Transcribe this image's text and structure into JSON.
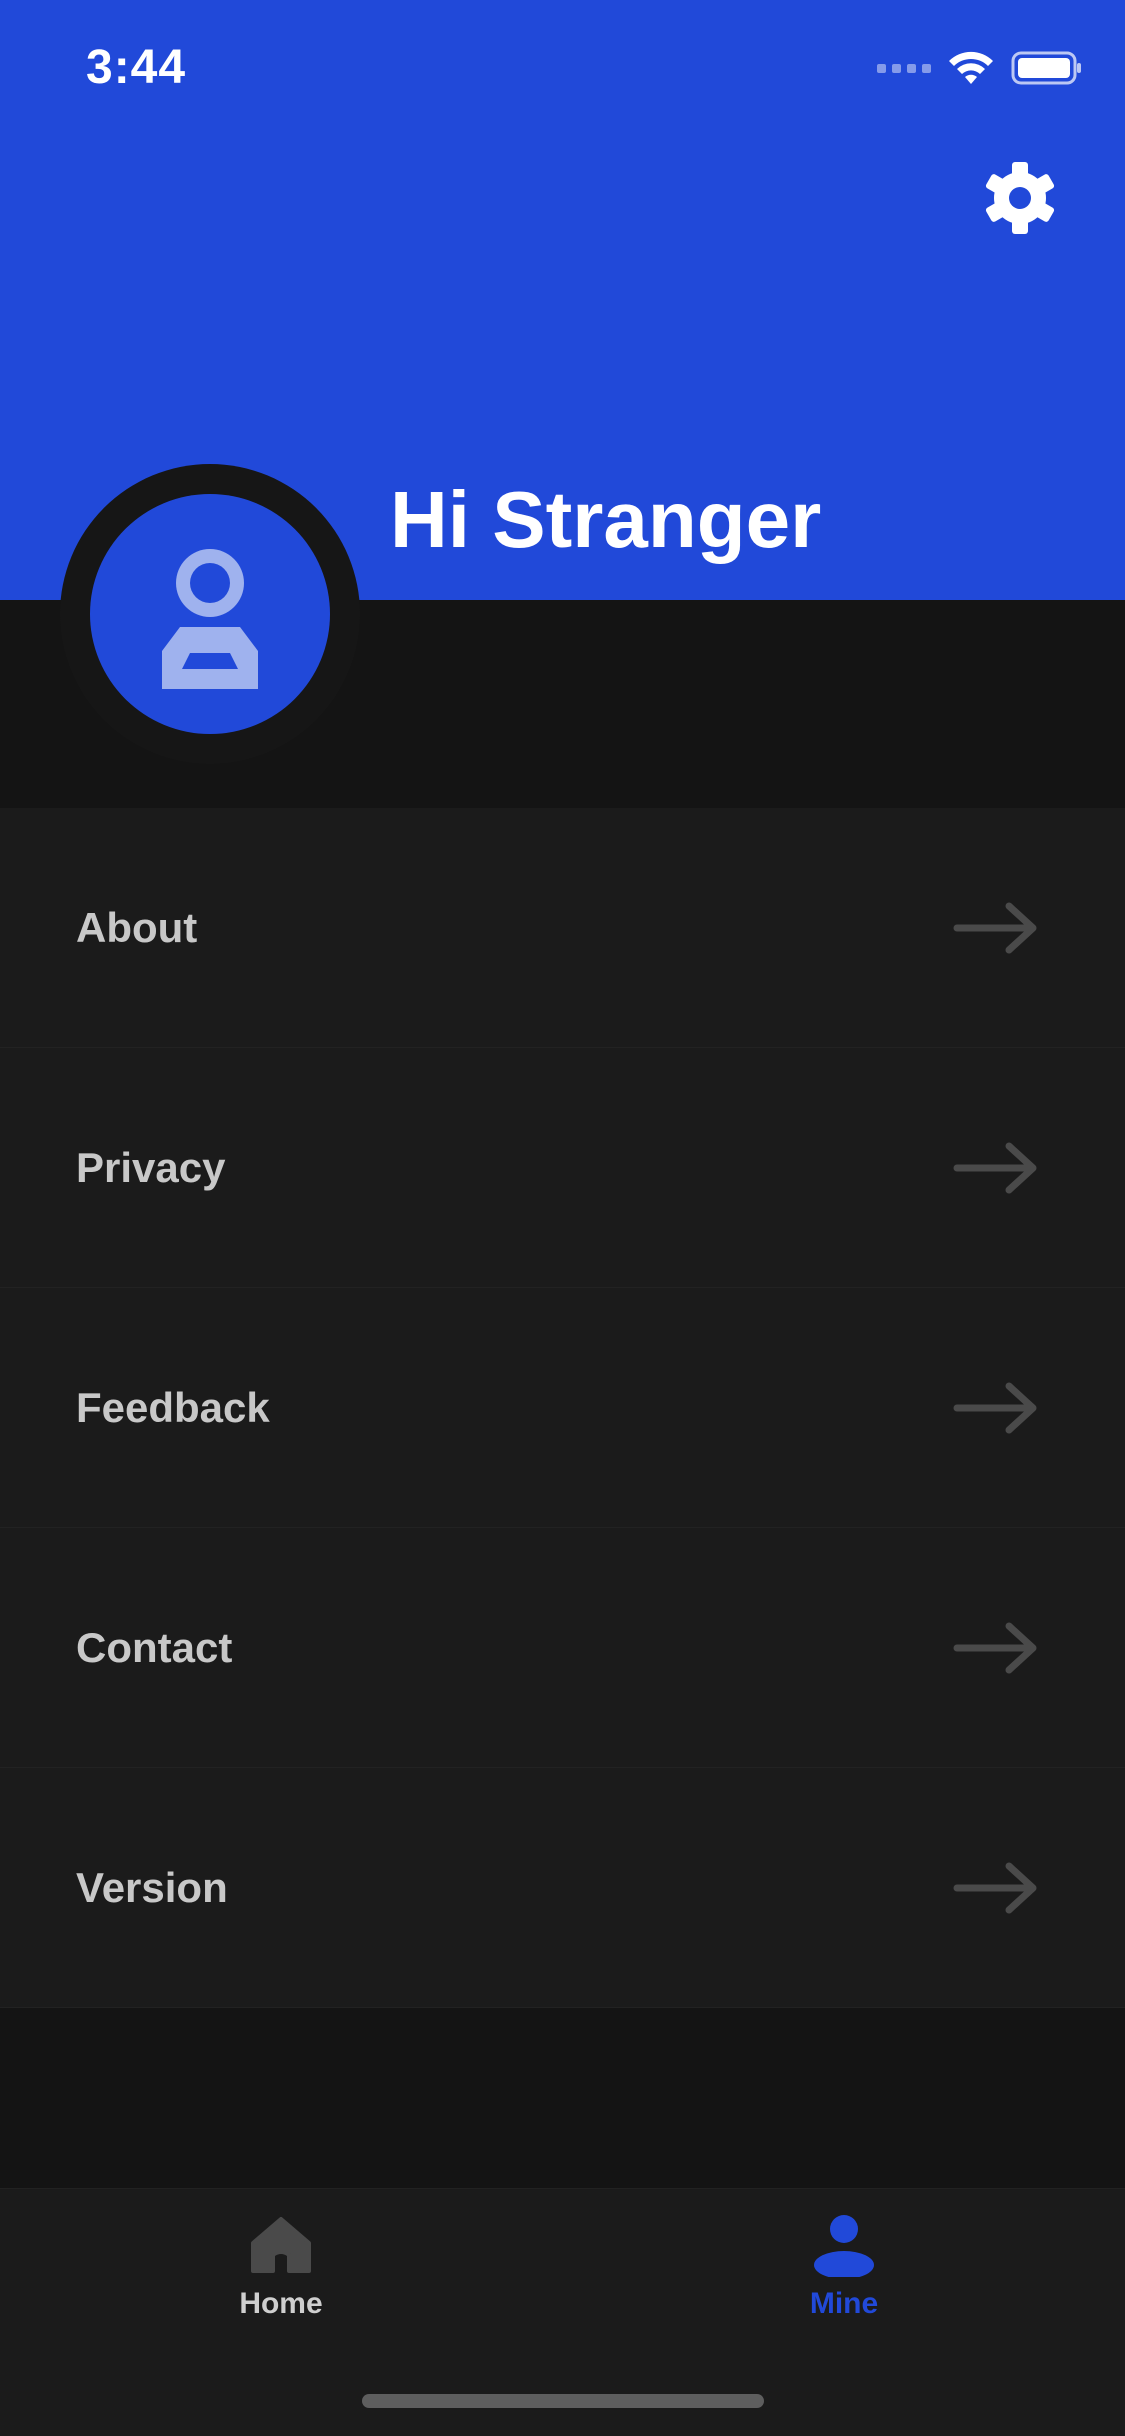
{
  "status_bar": {
    "time": "3:44",
    "icons": [
      "cellular-signal-icon",
      "wifi-icon",
      "battery-icon"
    ]
  },
  "header": {
    "background_color": "#2149d9",
    "settings_icon": "gear-icon",
    "greeting": "Hi Stranger",
    "avatar_icon": "person-icon"
  },
  "menu": {
    "items": [
      {
        "label": "About",
        "icon": "arrow-right-icon"
      },
      {
        "label": "Privacy",
        "icon": "arrow-right-icon"
      },
      {
        "label": "Feedback",
        "icon": "arrow-right-icon"
      },
      {
        "label": "Contact",
        "icon": "arrow-right-icon"
      },
      {
        "label": "Version",
        "icon": "arrow-right-icon"
      }
    ]
  },
  "tab_bar": {
    "tabs": [
      {
        "label": "Home",
        "icon": "home-icon",
        "active": false
      },
      {
        "label": "Mine",
        "icon": "person-icon",
        "active": true
      }
    ],
    "active_color": "#2149d9",
    "inactive_color": "#cfcfcf"
  }
}
